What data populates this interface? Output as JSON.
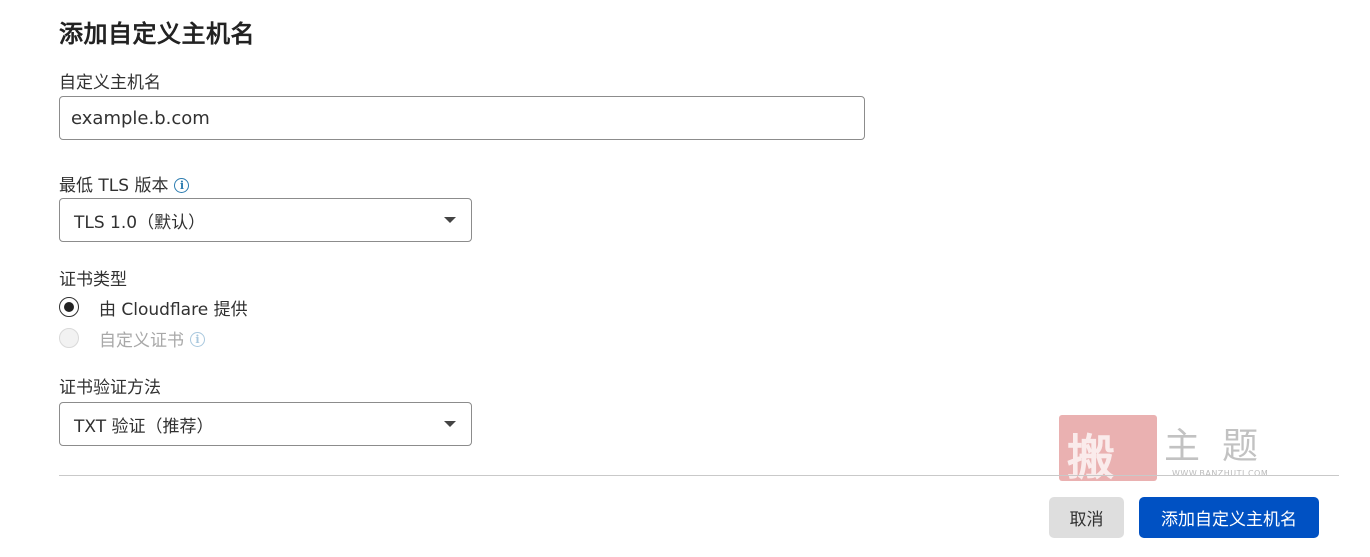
{
  "form": {
    "title": "添加自定义主机名",
    "hostname": {
      "label": "自定义主机名",
      "value": "example.b.com"
    },
    "min_tls": {
      "label": "最低 TLS 版本",
      "info_icon": "info-icon",
      "selected": "TLS 1.0（默认）"
    },
    "cert_type": {
      "label": "证书类型",
      "options": [
        {
          "label": "由 Cloudflare 提供",
          "selected": true,
          "disabled": false
        },
        {
          "label": "自定义证书",
          "selected": false,
          "disabled": true,
          "info_icon": "info-icon"
        }
      ]
    },
    "cert_validation": {
      "label": "证书验证方法",
      "selected": "TXT 验证（推荐）"
    }
  },
  "actions": {
    "cancel_label": "取消",
    "submit_label": "添加自定义主机名"
  },
  "watermark": {
    "seal_glyph": "搬",
    "text": "主题",
    "url": "WWW.BANZHUTI.COM"
  },
  "colors": {
    "primary": "#0051c3",
    "cancel_bg": "#dedede",
    "info": "#2c7cb0",
    "text": "#313131"
  }
}
